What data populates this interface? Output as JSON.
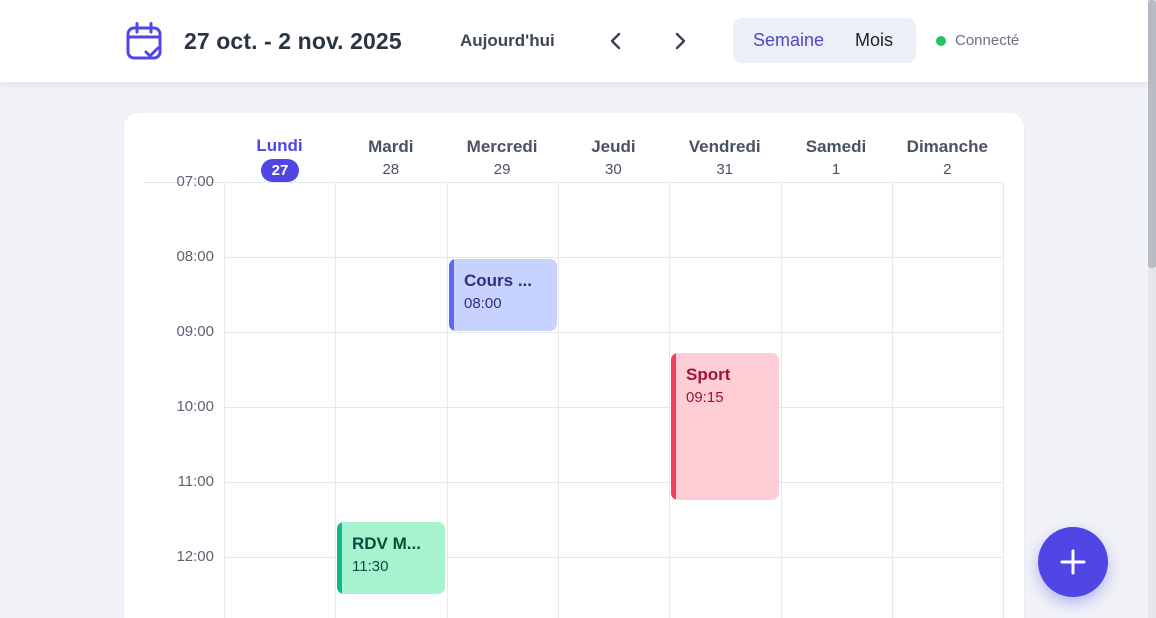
{
  "header": {
    "range_title": "27 oct. - 2 nov. 2025",
    "today_label": "Aujourd'hui",
    "prev_icon": "chevron-left-icon",
    "next_icon": "chevron-right-icon",
    "calendar_icon": "calendar-check-icon",
    "view_week": "Semaine",
    "view_month": "Mois",
    "active_view": "Semaine",
    "status_text": "Connecté",
    "status_color": "#22c55e"
  },
  "days": [
    {
      "name": "Lundi",
      "num": "27",
      "today": true
    },
    {
      "name": "Mardi",
      "num": "28",
      "today": false
    },
    {
      "name": "Mercredi",
      "num": "29",
      "today": false
    },
    {
      "name": "Jeudi",
      "num": "30",
      "today": false
    },
    {
      "name": "Vendredi",
      "num": "31",
      "today": false
    },
    {
      "name": "Samedi",
      "num": "1",
      "today": false
    },
    {
      "name": "Dimanche",
      "num": "2",
      "today": false
    }
  ],
  "hours": [
    "07:00",
    "08:00",
    "09:00",
    "10:00",
    "11:00",
    "12:00"
  ],
  "events": [
    {
      "title": "Cours ...",
      "time": "08:00",
      "day": 2,
      "start_hour": 8.0,
      "duration_hours": 1.0,
      "bg": "#c7d2fe",
      "accent": "#6366f1",
      "text": "#312e81"
    },
    {
      "title": "Sport",
      "time": "09:15",
      "day": 4,
      "start_hour": 9.25,
      "duration_hours": 2.0,
      "bg": "#fecdd6",
      "accent": "#f43f5e",
      "text": "#9f1239"
    },
    {
      "title": "RDV M...",
      "time": "11:30",
      "day": 1,
      "start_hour": 11.5,
      "duration_hours": 1.0,
      "bg": "#a7f3d0",
      "accent": "#10b981",
      "text": "#064e3b"
    }
  ],
  "fab_icon": "plus-icon",
  "colors": {
    "accent": "#4f46e5",
    "background": "#f0f2f7"
  }
}
